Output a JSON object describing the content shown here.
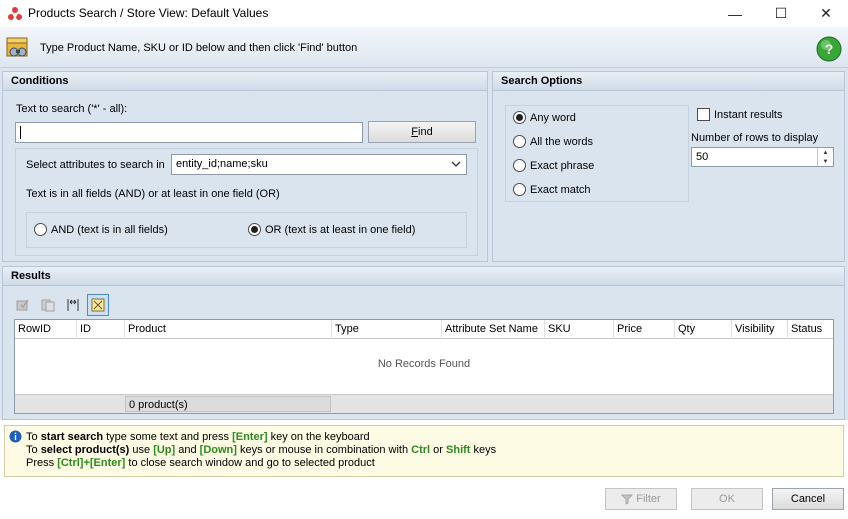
{
  "window": {
    "title": "Products Search / Store View: Default Values",
    "minimize_glyph": "—",
    "maximize_glyph": "☐",
    "close_glyph": "✕"
  },
  "banner": {
    "text": "Type Product Name, SKU or ID below and then click 'Find' button"
  },
  "conditions": {
    "header": "Conditions",
    "text_label": "Text to search ('*' - all):",
    "text_value": "",
    "find_button": "Find",
    "attributes_label": "Select attributes to search in",
    "attributes_value": "entity_id;name;sku",
    "mode_label": "Text is in all fields (AND) or at least in one field (OR)",
    "and_option": "AND (text is in all fields)",
    "or_option": "OR (text is at least in one field)",
    "selected_mode": "OR"
  },
  "search_options": {
    "header": "Search Options",
    "options": [
      "Any word",
      "All the words",
      "Exact phrase",
      "Exact match"
    ],
    "selected": "Any word",
    "instant_results_label": "Instant results",
    "instant_results_checked": false,
    "rows_label": "Number of rows to display",
    "rows_value": "50"
  },
  "results": {
    "header": "Results",
    "columns": [
      "RowID",
      "ID",
      "Product",
      "Type",
      "Attribute Set Name",
      "SKU",
      "Price",
      "Qty",
      "Visibility",
      "Status"
    ],
    "empty_text": "No Records Found",
    "footer_count": "0 product(s)"
  },
  "hints": {
    "line1_a": "To ",
    "line1_b": "start search",
    "line1_c": " type some text and press ",
    "line1_d": "[Enter]",
    "line1_e": " key on the keyboard",
    "line2_a": "To ",
    "line2_b": "select product(s)",
    "line2_c": " use ",
    "line2_d": "[Up]",
    "line2_e": " and ",
    "line2_f": "[Down]",
    "line2_g": " keys or mouse in combination with ",
    "line2_h": "Ctrl",
    "line2_i": " or ",
    "line2_j": "Shift",
    "line2_k": " keys",
    "line3_a": "Press ",
    "line3_b": "[Ctrl]+[Enter]",
    "line3_c": " to close search window and go to selected product"
  },
  "buttons": {
    "filter": "Filter",
    "ok": "OK",
    "cancel": "Cancel"
  },
  "colors": {
    "panel_bg": "#dbe5f0",
    "hint_key": "#2e8b20",
    "hint_bg": "#fdfbe3"
  }
}
